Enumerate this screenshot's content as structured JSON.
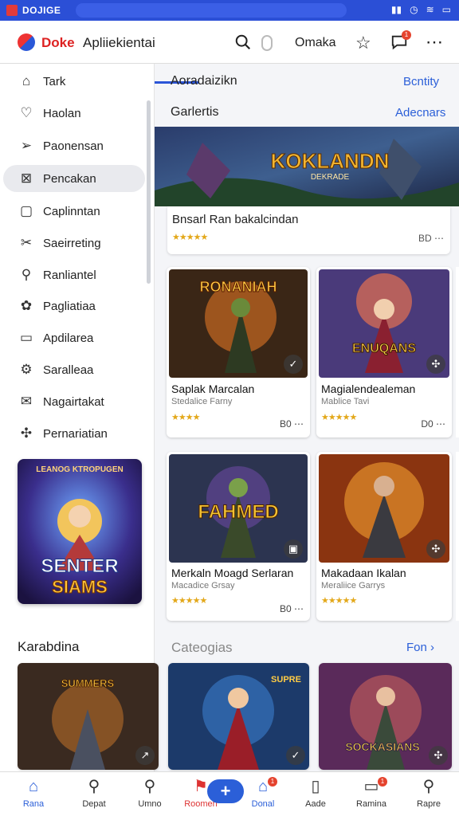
{
  "status_bar": {
    "left_text": "DOJIGE"
  },
  "header": {
    "brand": "Doke",
    "app_name": "Apliiekientai",
    "action_label": "Omaka",
    "chat_badge": "1"
  },
  "sidebar": {
    "items": [
      {
        "label": "Tark",
        "icon": "home-icon"
      },
      {
        "label": "Haolan",
        "icon": "heart-icon"
      },
      {
        "label": "Paonensan",
        "icon": "send-icon"
      },
      {
        "label": "Pencakan",
        "icon": "puzzle-icon",
        "active": true
      },
      {
        "label": "Caplinntan",
        "icon": "tablet-icon"
      },
      {
        "label": "Saeirreting",
        "icon": "tools-icon"
      },
      {
        "label": "Ranliantel",
        "icon": "search-icon"
      },
      {
        "label": "Pagliatiaa",
        "icon": "palette-icon"
      },
      {
        "label": "Apdilarea",
        "icon": "folder-icon"
      },
      {
        "label": "Saralleaa",
        "icon": "gear-icon"
      },
      {
        "label": "Nagairtakat",
        "icon": "mail-icon"
      },
      {
        "label": "Pernariatian",
        "icon": "gamepad-icon"
      }
    ],
    "promo": {
      "top_text": "LEANOG KTROPUGEN",
      "title_line1": "SENTER",
      "title_line2": "SIAMS"
    }
  },
  "main": {
    "section1": {
      "title": "Aoradaizikn",
      "link": "Bcntity"
    },
    "section2": {
      "title": "Garlertis",
      "link": "Adecnars"
    },
    "banner": {
      "title": "KOKLANDN",
      "subtitle": "DEKRADE"
    },
    "featured": {
      "title": "Bnsarl Ran bakalcindan",
      "meta": "BD",
      "stars": "★★★★★"
    },
    "cards": [
      {
        "title": "Saplak Marcalan",
        "sub": "Stedalice Farny",
        "stars": "★★★★",
        "meta": "B0",
        "art": "RONANIAH"
      },
      {
        "title": "Magialendealeman",
        "sub": "Mablice Tavi",
        "stars": "★★★★★",
        "meta": "D0",
        "art": "ENUQANS"
      },
      {
        "title": "Merkaln Moagd Serlaran",
        "sub": "Macadice Grsay",
        "stars": "★★★★★",
        "meta": "B0",
        "art": "FAHMED"
      },
      {
        "title": "Makadaan Ikalan",
        "sub": "Meraliice Garrys",
        "stars": "★★★★★",
        "meta": "",
        "art": ""
      }
    ],
    "bottom_section": {
      "left_title": "Karabdina",
      "mid_title": "Cateogias",
      "right_link": "Fon",
      "tiles": [
        {
          "art": "SUMMERS"
        },
        {
          "art": "SUPRE"
        },
        {
          "art": "SOCKASIANS"
        }
      ]
    }
  },
  "bottom_nav": {
    "items": [
      {
        "label": "Rana",
        "icon": "home-icon"
      },
      {
        "label": "Depat",
        "icon": "search-icon"
      },
      {
        "label": "Umno",
        "icon": "search-icon"
      },
      {
        "label": "Roomen",
        "icon": "pin-icon"
      },
      {
        "label": "Donal",
        "icon": "house-icon"
      },
      {
        "label": "Aade",
        "icon": "book-icon"
      },
      {
        "label": "Ramina",
        "icon": "inbox-icon"
      },
      {
        "label": "Rapre",
        "icon": "user-icon"
      }
    ],
    "badges": {
      "donal": "1",
      "ramina": "1"
    }
  }
}
